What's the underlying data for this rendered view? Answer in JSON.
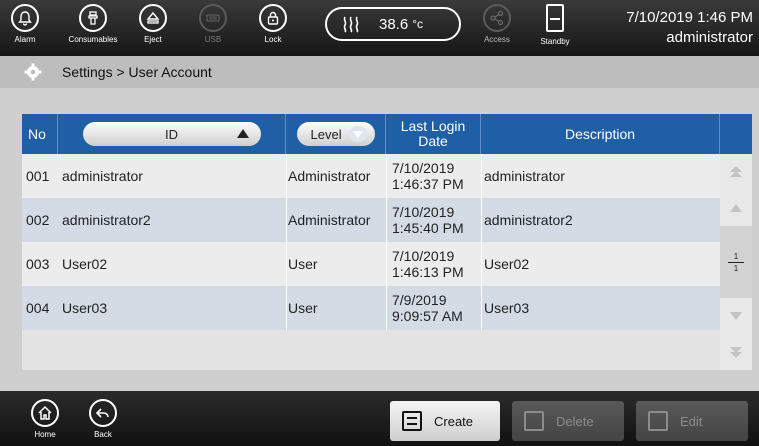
{
  "topbar": {
    "buttons": [
      {
        "label": "Alarm",
        "icon": "bell-icon"
      },
      {
        "label": "Consumables",
        "icon": "consumables-icon"
      },
      {
        "label": "Eject",
        "icon": "eject-icon"
      },
      {
        "label": "USB",
        "icon": "usb-icon"
      },
      {
        "label": "Lock",
        "icon": "lock-icon"
      },
      {
        "label": "Access",
        "icon": "share-icon"
      },
      {
        "label": "Standby",
        "icon": "standby-icon"
      }
    ],
    "temperature": {
      "value": "38.6",
      "unit": "°c",
      "icon": "heat-icon"
    },
    "date_time": "7/10/2019 1:46 PM",
    "user": "administrator"
  },
  "breadcrumb": {
    "icon": "gear-icon",
    "text": "Settings > User Account"
  },
  "table": {
    "headers": {
      "no": "No",
      "id": "ID",
      "level": "Level",
      "login_line1": "Last Login",
      "login_line2": "Date",
      "description": "Description"
    },
    "rows": [
      {
        "no": "001",
        "id": "administrator",
        "level": "Administrator",
        "date": "7/10/2019",
        "time": "1:46:37 PM",
        "description": "administrator"
      },
      {
        "no": "002",
        "id": "administrator2",
        "level": "Administrator",
        "date": "7/10/2019",
        "time": "1:45:40 PM",
        "description": "administrator2"
      },
      {
        "no": "003",
        "id": "User02",
        "level": "User",
        "date": "7/10/2019",
        "time": "1:46:13 PM",
        "description": "User02"
      },
      {
        "no": "004",
        "id": "User03",
        "level": "User",
        "date": "7/9/2019",
        "time": "9:09:57 AM",
        "description": "User03"
      }
    ],
    "pager": {
      "current": "1",
      "total": "1"
    }
  },
  "bottombar": {
    "home_label": "Home",
    "back_label": "Back",
    "create_label": "Create",
    "delete_label": "Delete",
    "edit_label": "Edit"
  },
  "colors": {
    "header_blue": "#1f5fa5",
    "row_odd": "#ececec",
    "row_even": "#d5dbe4"
  }
}
